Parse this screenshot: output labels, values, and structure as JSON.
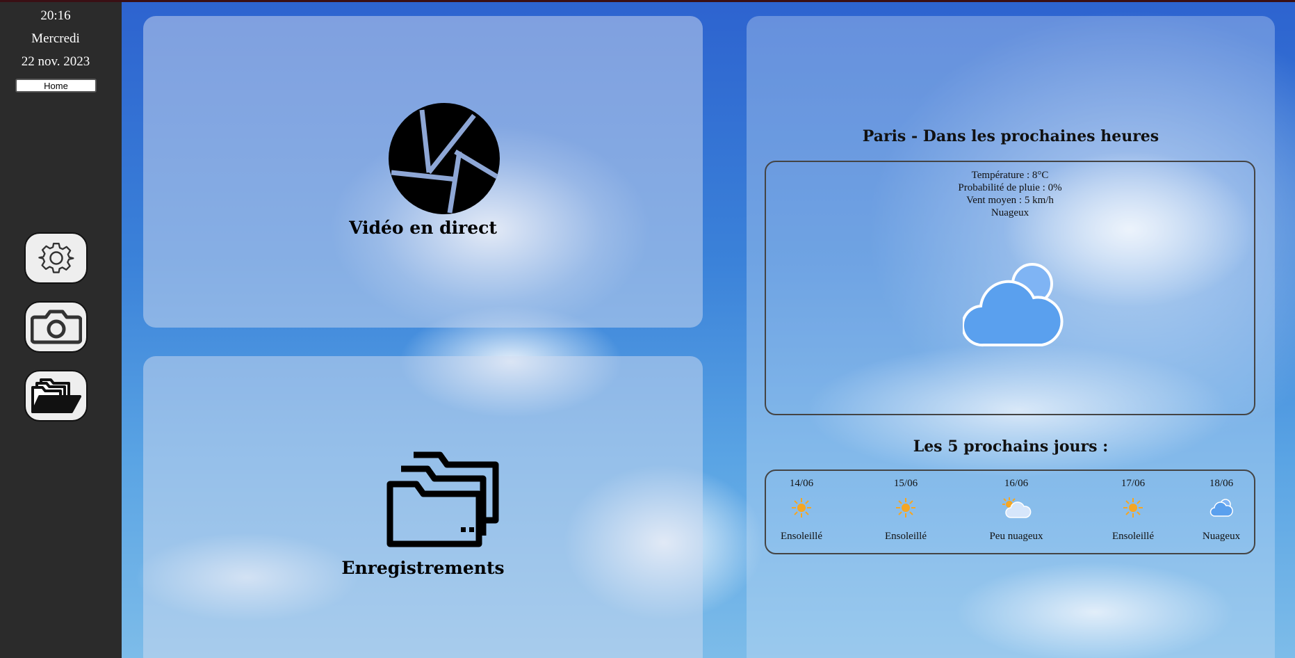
{
  "sidebar": {
    "time": "20:16",
    "day": "Mercredi",
    "date": "22 nov. 2023",
    "home_label": "Home",
    "icons": [
      "gear-icon",
      "camera-icon",
      "folders-icon"
    ]
  },
  "tiles": {
    "live_video_label": "Vidéo en direct",
    "recordings_label": "Enregistrements"
  },
  "weather": {
    "title": "Paris - Dans les prochaines heures",
    "temperature": "Température : 8°C",
    "rain": "Probabilité de pluie : 0%",
    "wind": "Vent moyen : 5 km/h",
    "condition": "Nuageux",
    "forecast_title": "Les 5 prochains jours :",
    "days": [
      {
        "date": "14/06",
        "condition": "Ensoleillé",
        "icon": "sun-icon"
      },
      {
        "date": "15/06",
        "condition": "Ensoleillé",
        "icon": "sun-icon"
      },
      {
        "date": "16/06",
        "condition": "Peu nuageux",
        "icon": "partly-cloudy-icon"
      },
      {
        "date": "17/06",
        "condition": "Ensoleillé",
        "icon": "sun-icon"
      },
      {
        "date": "18/06",
        "condition": "Nuageux",
        "icon": "cloud-icon"
      }
    ]
  },
  "colors": {
    "sidebar_bg": "#2b2b2b",
    "sky": "#3b82d9",
    "sun": "#f5a623",
    "cloud": "#5aa0ee"
  }
}
